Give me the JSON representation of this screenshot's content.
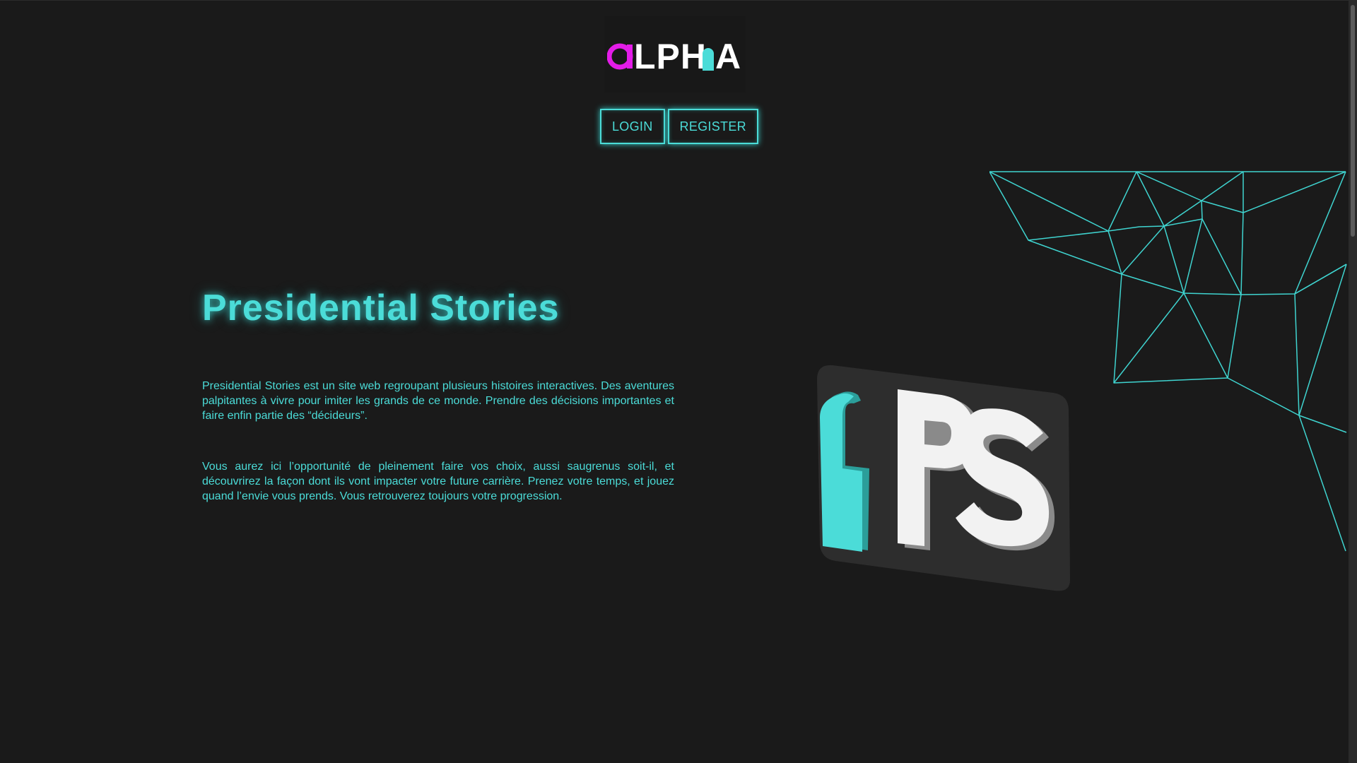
{
  "header": {
    "logo": {
      "text_main": "LPH",
      "text_end": "A",
      "accent_color": "#e31ce8",
      "secondary_color": "#4bdcd8"
    },
    "buttons": {
      "login_label": "LOGIN",
      "register_label": "REGISTER"
    }
  },
  "hero": {
    "title": "Presidential Stories",
    "paragraph_1": "Presidential Stories est un site web regroupant plusieurs histoires interactives. Des aventures palpitantes à vivre pour imiter les grands de ce monde. Prendre des décisions importantes et faire enfin partie des “décideurs”.",
    "paragraph_2": "Vous aurez ici l’opportunité de pleinement faire vos choix, aussi saugrenus soit-il, et découvrirez la façon dont ils vont impacter votre future carrière. Prenez votre temps, et jouez quand l’envie vous prends. Vous retrouverez toujours votre progression."
  },
  "illustration": {
    "logo_letters": "PS",
    "network_color": "#3fd4d0",
    "ps_accent": "#4bdcd8",
    "ps_text_color": "#f2f2f2",
    "ps_card_color": "#2d2d2d",
    "icon": "network-mesh-icon"
  },
  "theme": {
    "background": "#1a1a1a",
    "accent": "#4bdcd8"
  }
}
